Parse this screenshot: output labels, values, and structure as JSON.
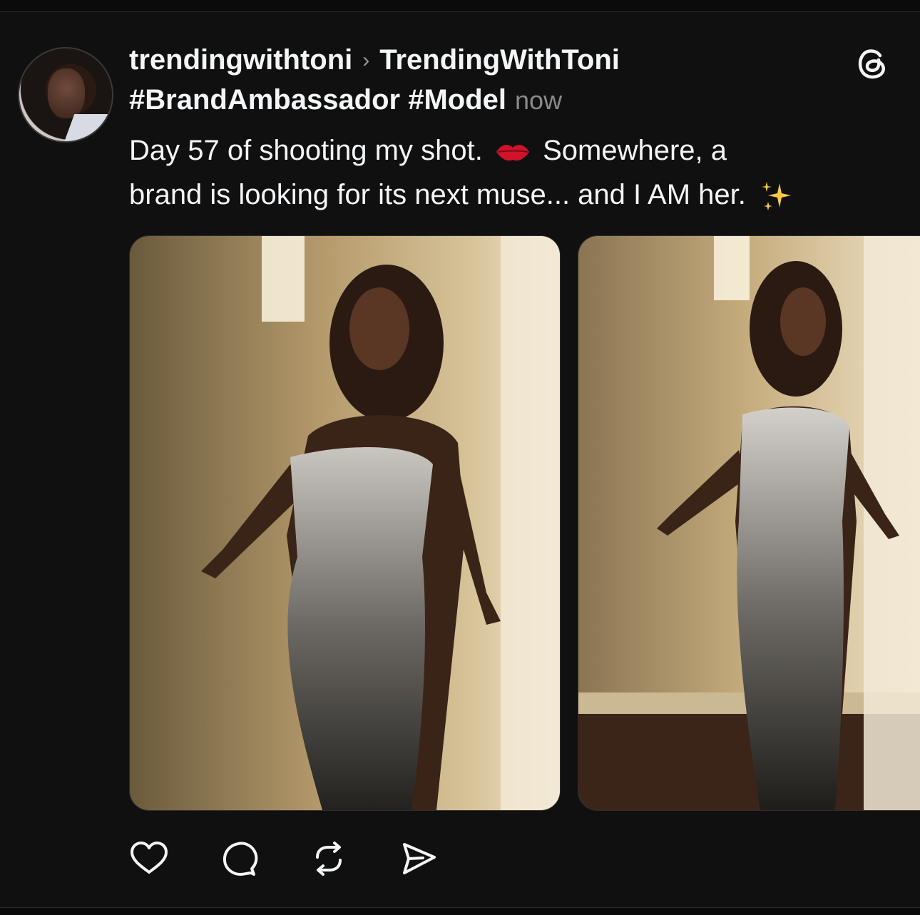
{
  "post": {
    "username": "trendingwithtoni",
    "separator": "›",
    "community": "TrendingWithToni",
    "tags": "#BrandAmbassador #Model",
    "time": "now",
    "caption_line1_a": "Day 57 of shooting my shot.",
    "caption_line1_b": "Somewhere, a",
    "caption_line2": "brand is looking for its next muse... and I AM her.",
    "emoji_1": "kiss-lips-icon",
    "emoji_2": "sparkles-icon"
  },
  "media": {
    "count": 2,
    "photos": [
      "photo-woman-sequin-gown-1",
      "photo-woman-sequin-gown-2"
    ]
  },
  "actions": {
    "icons": [
      "heart-icon",
      "comment-icon",
      "repost-icon",
      "share-icon"
    ]
  },
  "colors": {
    "background": "#101010",
    "text": "#f3f5f7",
    "muted": "#8a8a8a"
  }
}
